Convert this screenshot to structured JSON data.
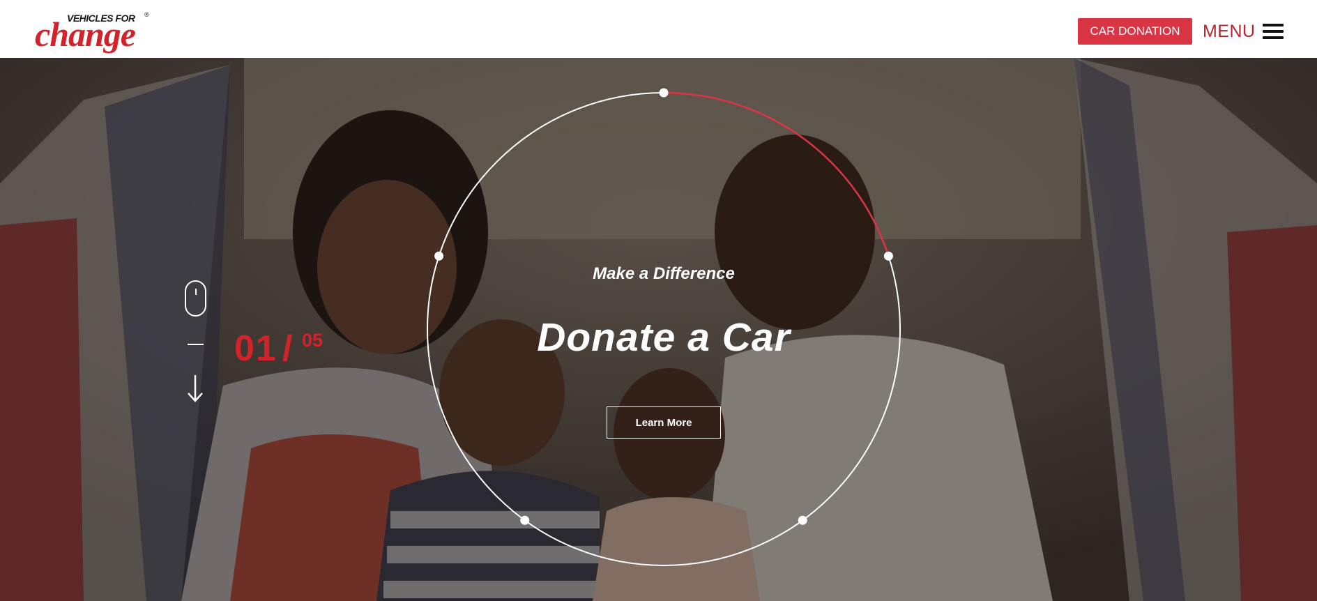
{
  "header": {
    "logo": {
      "top_text": "VEHICLES FOR",
      "main_text": "change",
      "registered": "®"
    },
    "cta_label": "CAR DONATION",
    "menu_label": "MENU"
  },
  "hero": {
    "eyebrow": "Make a Difference",
    "headline": "Donate a Car",
    "button_label": "Learn More",
    "slide_current": "01",
    "slide_separator": "/",
    "slide_total": "05",
    "progress_fraction": 0.2
  },
  "colors": {
    "brand_red": "#d2232a",
    "button_red": "#d93444",
    "menu_red": "#b5242f"
  },
  "icons": [
    "hamburger-icon",
    "mouse-scroll-icon",
    "down-arrow-icon"
  ]
}
